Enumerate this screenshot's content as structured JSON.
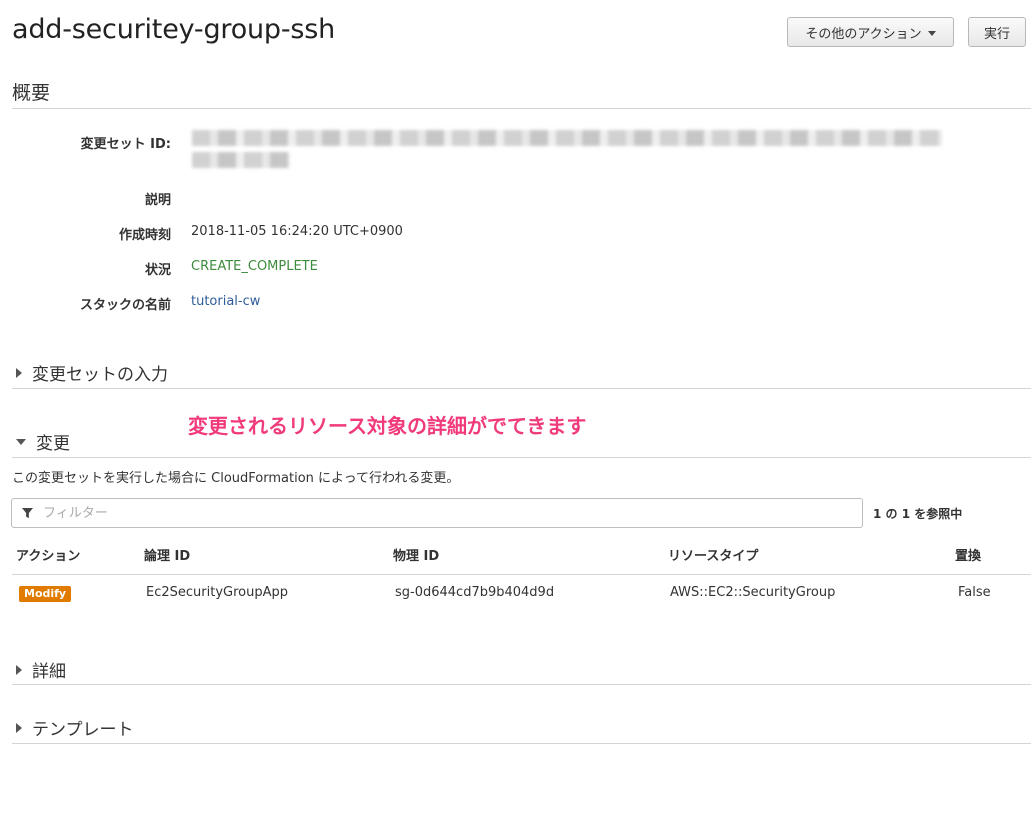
{
  "header": {
    "title": "add-securitey-group-ssh",
    "actions_label": "その他のアクション",
    "execute_label": "実行"
  },
  "overview": {
    "title": "概要",
    "fields": [
      {
        "label": "変更セット ID:",
        "value": ""
      },
      {
        "label": "説明",
        "value": ""
      },
      {
        "label": "作成時刻",
        "value": "2018-11-05 16:24:20 UTC+0900"
      },
      {
        "label": "状況",
        "value": "CREATE_COMPLETE",
        "color": "#3d8b3d"
      },
      {
        "label": "スタックの名前",
        "value": "tutorial-cw",
        "color": "#2f5d9a"
      }
    ]
  },
  "sections": {
    "inputs": "変更セットの入力",
    "changes": "変更",
    "details": "詳細",
    "template": "テンプレート"
  },
  "annotation": "変更されるリソース対象の詳細がでてきます",
  "changes": {
    "description": "この変更セットを実行した場合に CloudFormation によって行われる変更。",
    "filter_placeholder": "フィルター",
    "count": "1 の 1 を参照中",
    "columns": [
      "アクション",
      "論理 ID",
      "物理 ID",
      "リソースタイプ",
      "置換"
    ],
    "rows": [
      {
        "action": "Modify",
        "logical_id": "Ec2SecurityGroupApp",
        "physical_id": "sg-0d644cd7b9b404d9d",
        "resource_type": "AWS::EC2::SecurityGroup",
        "replacement": "False"
      }
    ]
  },
  "colors": {
    "badge": "#e07b00",
    "annotation": "#f03a7b",
    "status": "#3d8b3d",
    "link": "#2f5d9a"
  },
  "icons": {
    "actions_caret": "chevron-down-icon",
    "filter": "funnel-icon",
    "collapsed": "caret-right-icon",
    "expanded": "caret-down-icon"
  }
}
